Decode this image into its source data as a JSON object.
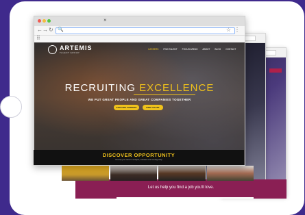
{
  "browser": {
    "nav_back": "←",
    "nav_forward": "→",
    "nav_reload": "↻",
    "search_icon": "🔍",
    "star_icon": "☆",
    "menu_icon": "⋮",
    "apps_icon": "⠿",
    "tab_close": "×"
  },
  "site": {
    "logo": "ARTEMIS",
    "logo_sub": "TALENT GROUP",
    "menu": [
      "CAREERS",
      "FIND TALENT",
      "FOCUS AREAS",
      "ABOUT",
      "BLOG",
      "CONTACT"
    ],
    "headline_white": "RECRUITING ",
    "headline_yellow": "EXCELLENCE",
    "tagline": "WE PUT GREAT PEOPLE AND GREAT COMPANIES TOGETHER",
    "cta_primary": "EXPLORE CAREERS",
    "cta_secondary": "FIND TALENT"
  },
  "discover": {
    "title": "DISCOVER OPPORTUNITY",
    "subtitle": "Develop your career in analysis, education and meeting today"
  },
  "banner": {
    "text": "Let us help you find a job you'll love."
  },
  "colors": {
    "background": "#3f2a8c",
    "accent": "#f0c21c",
    "banner": "#8a1f54"
  }
}
